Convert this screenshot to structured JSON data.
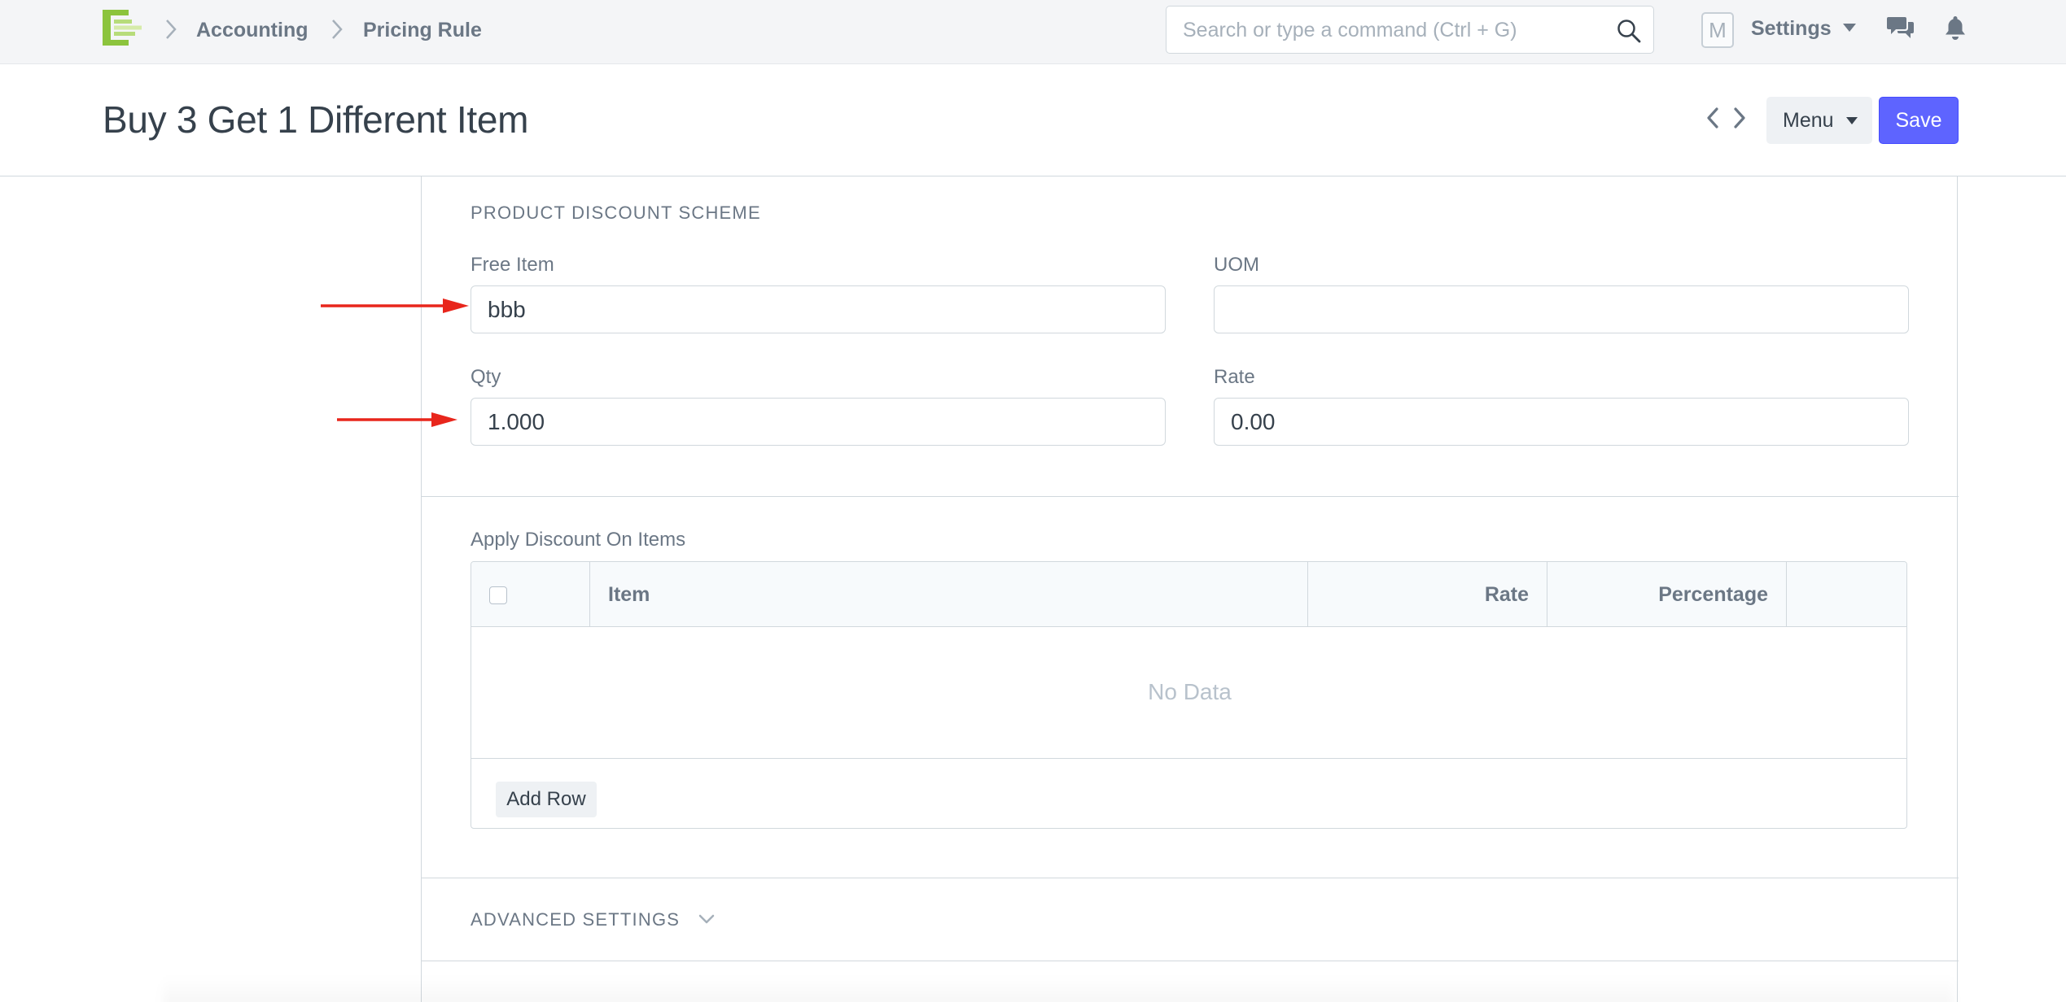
{
  "navbar": {
    "breadcrumbs": [
      "Accounting",
      "Pricing Rule"
    ],
    "search_placeholder": "Search or type a command (Ctrl + G)",
    "avatar_initial": "M",
    "settings_label": "Settings"
  },
  "page": {
    "title": "Buy 3 Get 1 Different Item",
    "menu_label": "Menu",
    "save_label": "Save"
  },
  "product_discount": {
    "section_title": "PRODUCT DISCOUNT SCHEME",
    "free_item": {
      "label": "Free Item",
      "value": "bbb"
    },
    "uom": {
      "label": "UOM",
      "value": ""
    },
    "qty": {
      "label": "Qty",
      "value": "1.000"
    },
    "rate": {
      "label": "Rate",
      "value": "0.00"
    }
  },
  "apply_discount": {
    "label": "Apply Discount On Items",
    "columns": [
      "Item",
      "Rate",
      "Percentage"
    ],
    "empty_text": "No Data",
    "add_row_label": "Add Row"
  },
  "advanced_settings": {
    "title": "ADVANCED SETTINGS"
  },
  "colors": {
    "primary": "#5e64ff",
    "annotation_arrow": "#e8261c",
    "logo_green": "#8cc43d"
  }
}
